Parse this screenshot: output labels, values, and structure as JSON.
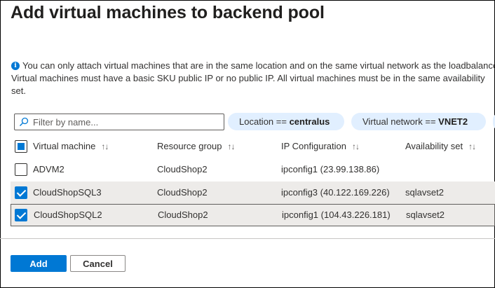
{
  "page": {
    "title": "Add virtual machines to backend pool",
    "info": {
      "icon": "info-icon",
      "line1": "You can only attach virtual machines that are in the same location and on the same virtual network as the loadbalancer.",
      "line2": "Virtual machines must have a basic SKU public IP or no public IP. All virtual machines must be in the same availability",
      "line3": "set."
    }
  },
  "filters": {
    "search_placeholder": "Filter by name...",
    "location": {
      "label": "Location ==",
      "value": "centralus"
    },
    "vnet": {
      "label": "Virtual network ==",
      "value": "VNET2"
    }
  },
  "table": {
    "columns": [
      "Virtual machine",
      "Resource group",
      "IP Configuration",
      "Availability set"
    ],
    "sort_glyph": "↑↓",
    "select_all_state": "partial",
    "rows": [
      {
        "checked": false,
        "vm": "ADVM2",
        "rg": "CloudShop2",
        "ip": "ipconfig1 (23.99.138.86)",
        "as": ""
      },
      {
        "checked": true,
        "vm": "CloudShopSQL3",
        "rg": "CloudShop2",
        "ip": "ipconfig3 (40.122.169.226)",
        "as": "sqlavset2"
      },
      {
        "checked": true,
        "vm": "CloudShopSQL2",
        "rg": "CloudShop2",
        "ip": "ipconfig1 (104.43.226.181)",
        "as": "sqlavset2"
      }
    ]
  },
  "footer": {
    "add_label": "Add",
    "cancel_label": "Cancel"
  },
  "colors": {
    "accent": "#0078d4",
    "pill_bg": "#e1efff",
    "selected_row_bg": "#edebe9"
  }
}
